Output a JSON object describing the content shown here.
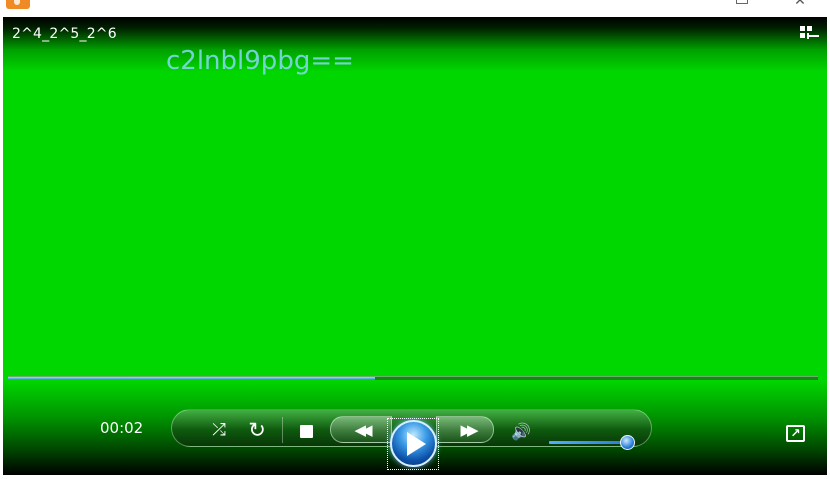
{
  "window": {
    "minimize_glyph": "",
    "close_glyph": "✕"
  },
  "video": {
    "title": "2^4_2^5_2^6",
    "watermark": "c2lnbl9pbg==",
    "background_color": "#00d700"
  },
  "playback": {
    "elapsed": "00:02",
    "progress_fraction": 0.56,
    "volume_fraction": 0.95
  },
  "controls": {
    "shuffle_glyph": "⤮",
    "repeat_glyph": "↻",
    "prev_glyph": "◀◀",
    "next_glyph": "▶▶",
    "mute_glyph": "🔊",
    "fullscreen_glyph": "↗"
  },
  "icons": [
    "app-icon",
    "switch-to-library-icon",
    "shuffle-icon",
    "repeat-icon",
    "stop-icon",
    "previous-icon",
    "play-icon",
    "next-icon",
    "volume-icon",
    "fullscreen-icon"
  ]
}
